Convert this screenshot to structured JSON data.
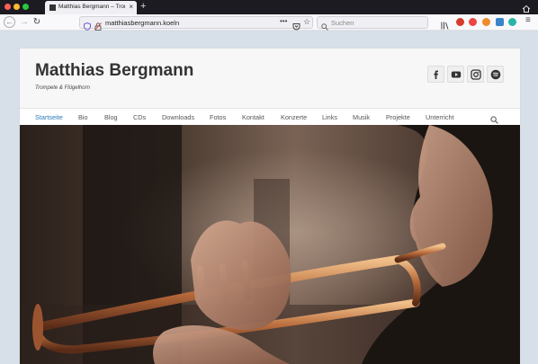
{
  "browser": {
    "tab_title": "Matthias Bergmann – Trompete & Flügelhorn",
    "url": "matthiasbergmann.koeln",
    "search_placeholder": "Suchen"
  },
  "site": {
    "title": "Matthias Bergmann",
    "tagline": "Trompete & Flügelhorn",
    "nav": [
      {
        "label": "Startseite",
        "active": true
      },
      {
        "label": "Bio"
      },
      {
        "label": "Blog"
      },
      {
        "label": "CDs"
      },
      {
        "label": "Downloads"
      },
      {
        "label": "Fotos"
      },
      {
        "label": "Kontakt"
      },
      {
        "label": "Konzerte"
      },
      {
        "label": "Links"
      },
      {
        "label": "Musik"
      },
      {
        "label": "Projekte"
      },
      {
        "label": "Unterricht"
      }
    ],
    "social": [
      "facebook-icon",
      "youtube-icon",
      "instagram-icon",
      "spotify-icon"
    ]
  },
  "colors": {
    "accent": "#2a7ab9",
    "header_bg": "#f7f7f7",
    "page_bg": "#d7dfe8"
  }
}
